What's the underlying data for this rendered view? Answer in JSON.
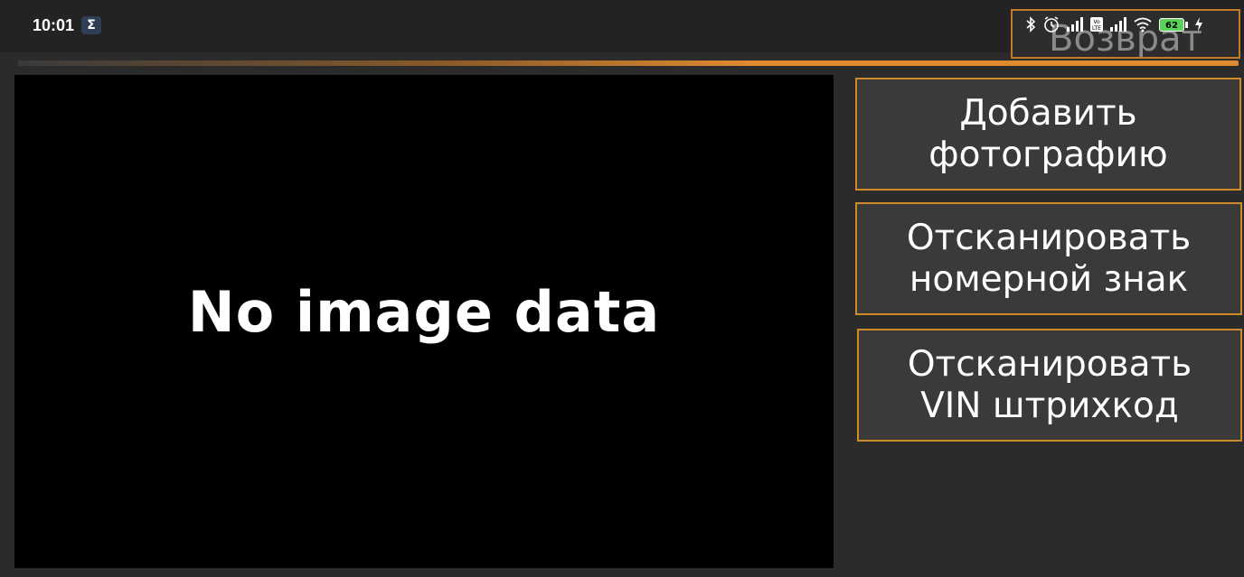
{
  "status_bar": {
    "time": "10:01",
    "app_badge": "Σ",
    "battery_level": "62",
    "icons": [
      "bluetooth-icon",
      "alarm-icon",
      "signal-icon",
      "volte-icon",
      "signal-icon",
      "wifi-icon",
      "battery-icon",
      "charging-icon"
    ]
  },
  "header": {
    "return_label": "Возврат"
  },
  "viewer": {
    "placeholder": "No image data"
  },
  "actions": [
    {
      "line1": "Добавить",
      "line2": "фотографию"
    },
    {
      "line1": "Отсканировать",
      "line2": "номерной знак"
    },
    {
      "line1": "Отсканировать",
      "line2": "VIN штрихкод"
    }
  ],
  "colors": {
    "accent": "#d18a2a",
    "background": "#2b2b2b",
    "button_bg": "#3a3a3a"
  }
}
